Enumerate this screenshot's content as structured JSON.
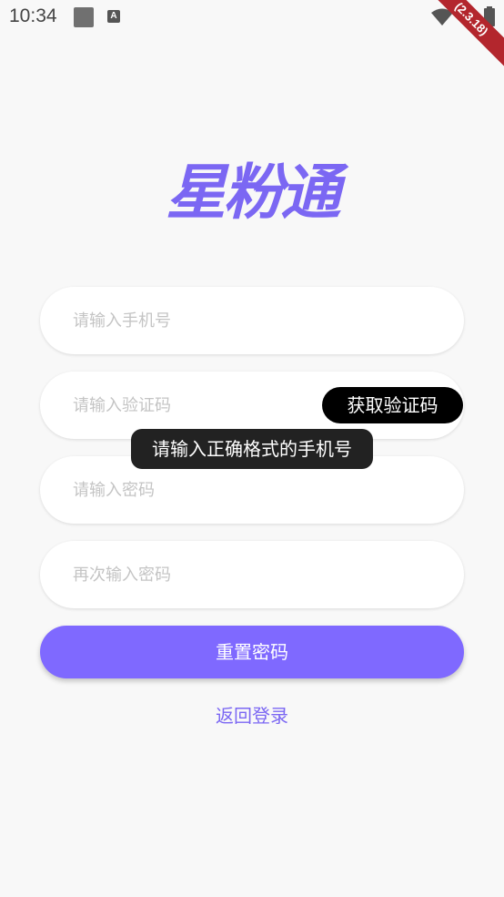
{
  "status_bar": {
    "time": "10:34",
    "notification_icons": [
      "gallery-icon",
      "a-icon"
    ],
    "system_icons": [
      "wifi-icon",
      "battery-icon"
    ]
  },
  "debug_banner": "(2.3.18)",
  "logo": "星粉通",
  "form": {
    "phone_placeholder": "请输入手机号",
    "code_placeholder": "请输入验证码",
    "get_code_label": "获取验证码",
    "password_placeholder": "请输入密码",
    "confirm_password_placeholder": "再次输入密码",
    "submit_label": "重置密码",
    "back_link": "返回登录"
  },
  "toast": "请输入正确格式的手机号",
  "colors": {
    "accent": "#7f69ff",
    "background": "#f8f8f8",
    "placeholder": "#c4c4c4"
  }
}
